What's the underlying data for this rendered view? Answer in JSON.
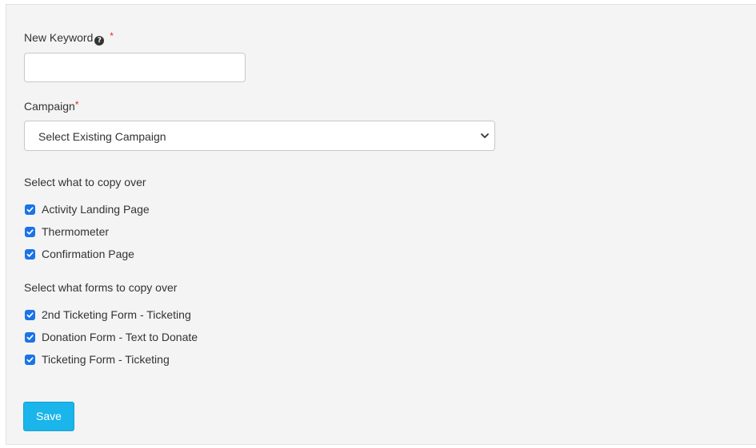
{
  "keyword": {
    "label": "New Keyword",
    "required_mark": "*",
    "help_icon": "question-circle-icon",
    "value": "",
    "placeholder": ""
  },
  "campaign": {
    "label": "Campaign",
    "required_mark": "*",
    "selected": "Select Existing Campaign",
    "chevron_icon": "chevron-down-icon"
  },
  "copy_section": {
    "heading": "Select what to copy over",
    "items": [
      {
        "label": "Activity Landing Page",
        "checked": true
      },
      {
        "label": "Thermometer",
        "checked": true
      },
      {
        "label": "Confirmation Page",
        "checked": true
      }
    ]
  },
  "forms_section": {
    "heading": "Select what forms to copy over",
    "items": [
      {
        "label": "2nd Ticketing Form - Ticketing",
        "checked": true
      },
      {
        "label": "Donation Form - Text to Donate",
        "checked": true
      },
      {
        "label": "Ticketing Form - Ticketing",
        "checked": true
      }
    ]
  },
  "actions": {
    "save_label": "Save"
  },
  "colors": {
    "checkbox": "#1a73e8",
    "save_button": "#1ab5ea",
    "required": "#e02b27",
    "panel_bg": "#f4f4f4"
  }
}
